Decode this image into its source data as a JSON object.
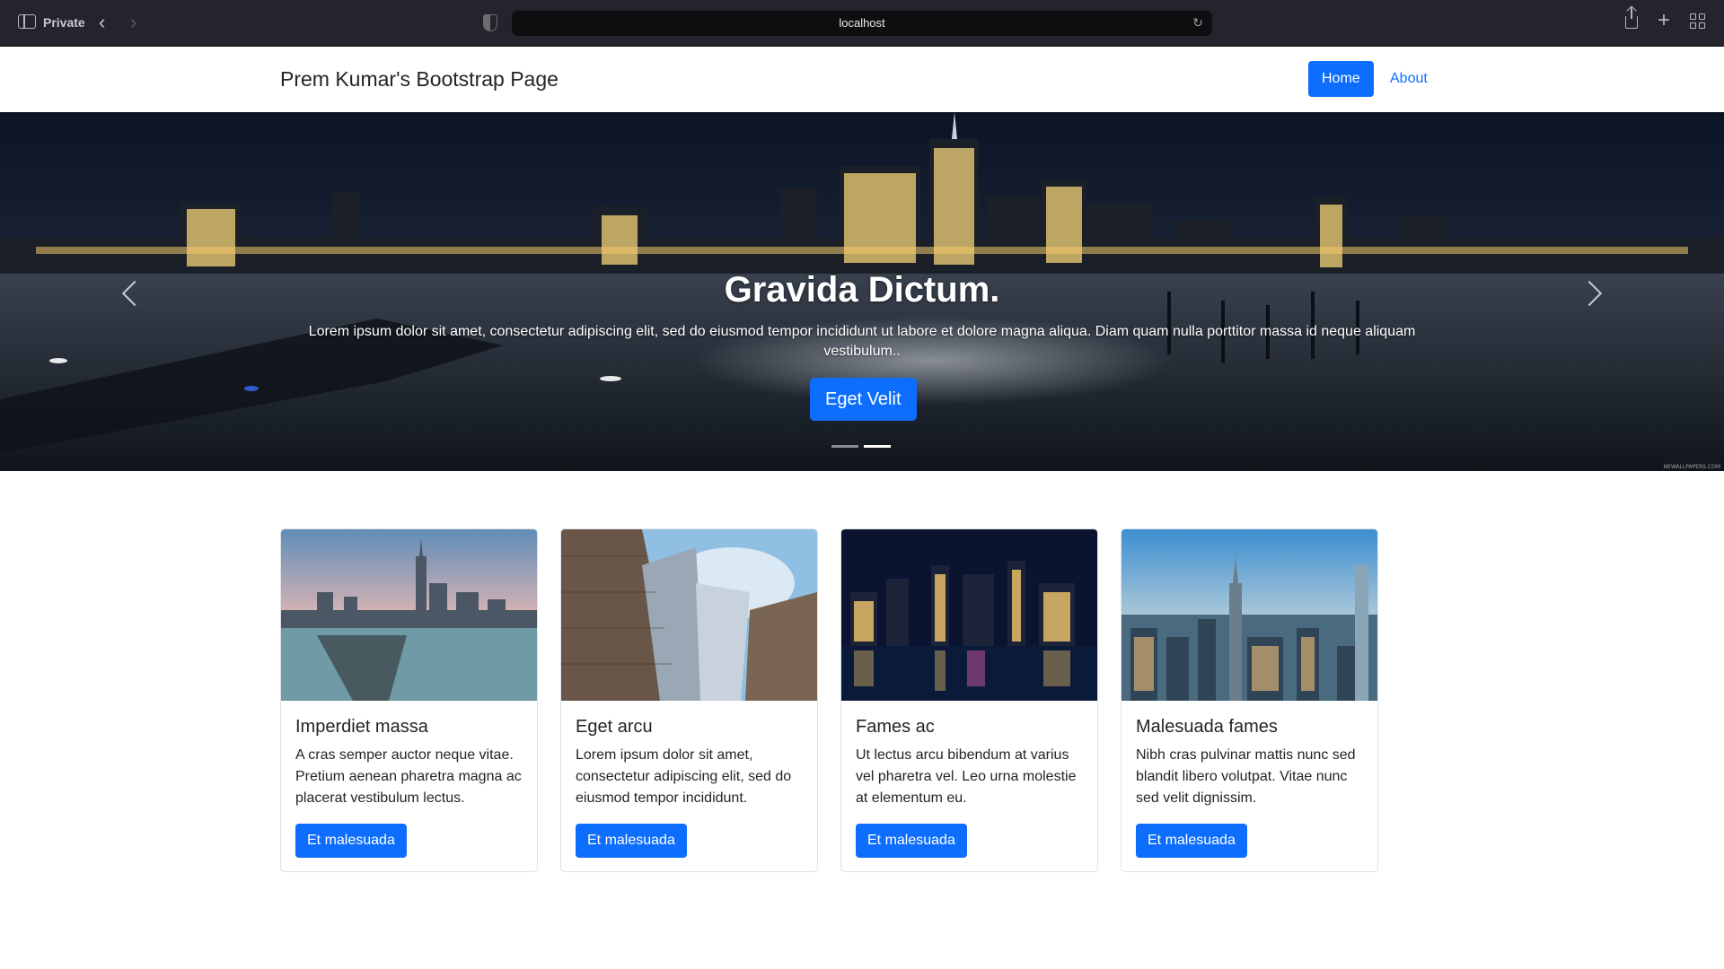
{
  "browser": {
    "mode_label": "Private",
    "url": "localhost"
  },
  "navbar": {
    "brand": "Prem Kumar's Bootstrap Page",
    "links": [
      {
        "label": "Home",
        "active": true
      },
      {
        "label": "About",
        "active": false
      }
    ]
  },
  "hero": {
    "title": "Gravida Dictum.",
    "text": "Lorem ipsum dolor sit amet, consectetur adipiscing elit, sed do eiusmod tempor incididunt ut labore et dolore magna aliqua. Diam quam nulla porttitor massa id neque aliquam vestibulum..",
    "button_label": "Eget Velit",
    "slide_count": 2,
    "active_slide": 2,
    "image_description": "city-skyline-at-night-over-water",
    "watermark": "NEWALLPAPERS.COM"
  },
  "cards": [
    {
      "image_description": "city-skyline-with-pier",
      "title": "Imperdiet massa",
      "text": "A cras semper auctor neque vitae. Pretium aenean pharetra magna ac placerat vestibulum lectus.",
      "button_label": "Et malesuada"
    },
    {
      "image_description": "skyscrapers-looking-up",
      "title": "Eget arcu",
      "text": "Lorem ipsum dolor sit amet, consectetur adipiscing elit, sed do eiusmod tempor incididunt.",
      "button_label": "Et malesuada"
    },
    {
      "image_description": "night-skyline-over-river",
      "title": "Fames ac",
      "text": "Ut lectus arcu bibendum at varius vel pharetra vel. Leo urna molestie at elementum eu.",
      "button_label": "Et malesuada"
    },
    {
      "image_description": "aerial-city-at-dusk",
      "title": "Malesuada fames",
      "text": "Nibh cras pulvinar mattis nunc sed blandit libero volutpat. Vitae nunc sed velit dignissim.",
      "button_label": "Et malesuada"
    }
  ],
  "colors": {
    "primary": "#0d6efd",
    "chrome_bg": "#25232b",
    "text": "#212529"
  }
}
